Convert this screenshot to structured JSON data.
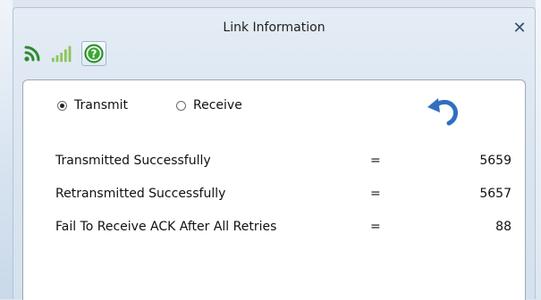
{
  "window": {
    "title": "Link Information",
    "close_symbol": "✕"
  },
  "toolbar": {
    "items": [
      {
        "icon": "wireless-signal-icon",
        "color": "#2e8b2e"
      },
      {
        "icon": "signal-strength-icon",
        "color": "#7fbf3f"
      },
      {
        "icon": "help-icon",
        "color": "#3aa535",
        "symbol": "?",
        "active": true
      }
    ]
  },
  "mode": {
    "transmit_label": "Transmit",
    "receive_label": "Receive",
    "selected": "transmit"
  },
  "refresh_icon": {
    "color": "#2f6fc0"
  },
  "stats": [
    {
      "label": "Transmitted Successfully",
      "eq": "=",
      "value": "5659"
    },
    {
      "label": "Retransmitted Successfully",
      "eq": "=",
      "value": "5657"
    },
    {
      "label": "Fail To Receive ACK After All Retries",
      "eq": "=",
      "value": "88"
    }
  ]
}
